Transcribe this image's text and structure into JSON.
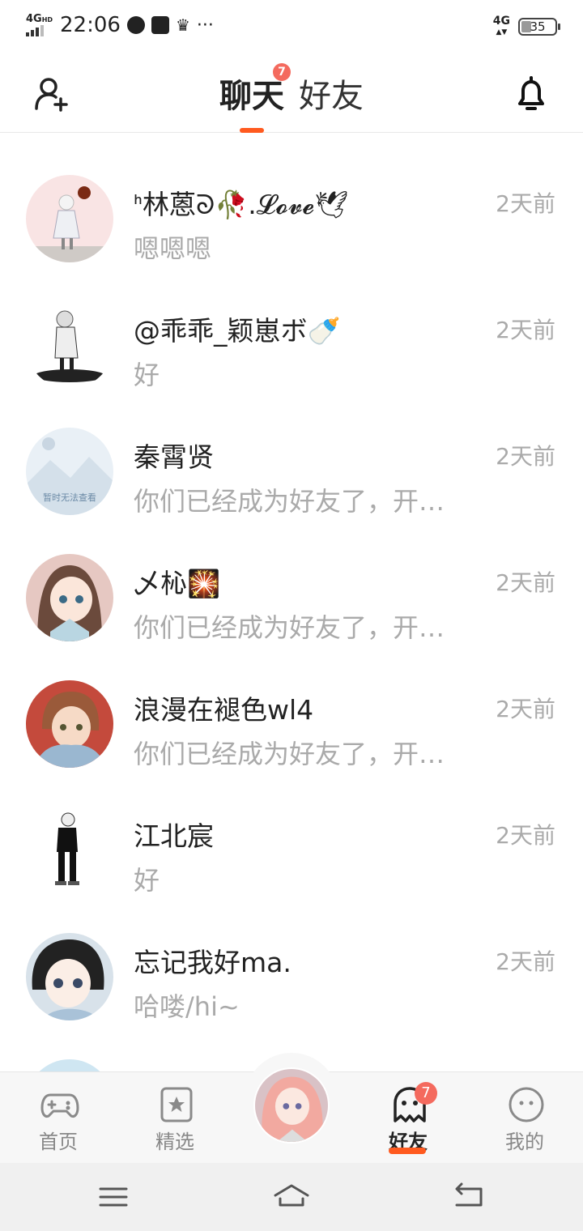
{
  "statusbar": {
    "network": "4G",
    "network_hd": "HD",
    "time": "22:06",
    "more": "···",
    "network_right": "4G",
    "battery": "35"
  },
  "header": {
    "tabs": [
      {
        "label": "聊天",
        "badge": "7",
        "active": true
      },
      {
        "label": "好友",
        "active": false
      }
    ]
  },
  "chats": [
    {
      "name": "ᑋ林蒽ᘐ🥀.𝓛𝓸𝓿𝓮🕊",
      "message": "嗯嗯嗯",
      "time": "2天前"
    },
    {
      "name": "@乖乖_颖崽ボ🍼",
      "message": "好",
      "time": "2天前"
    },
    {
      "name": "秦霄贤",
      "message": "你们已经成为好友了，开…",
      "time": "2天前",
      "avatar_text": "暂时无法查看"
    },
    {
      "name": "乄杺🎇",
      "message": "你们已经成为好友了，开…",
      "time": "2天前"
    },
    {
      "name": "浪漫在褪色wl4",
      "message": "你们已经成为好友了，开…",
      "time": "2天前"
    },
    {
      "name": "江北宸",
      "message": "好",
      "time": "2天前"
    },
    {
      "name": "忘记我好ma.",
      "message": "哈喽/hi~",
      "time": "2天前"
    }
  ],
  "tabbar": {
    "items": [
      {
        "label": "首页",
        "icon": "gamepad-icon"
      },
      {
        "label": "精选",
        "icon": "star-bookmark-icon"
      },
      {
        "label": "好友",
        "icon": "ghost-icon",
        "badge": "7",
        "active": true
      },
      {
        "label": "我的",
        "icon": "face-icon"
      }
    ]
  },
  "colors": {
    "accent": "#ff5a1f",
    "badge": "#f46a5e",
    "muted": "#aaaaaa"
  }
}
